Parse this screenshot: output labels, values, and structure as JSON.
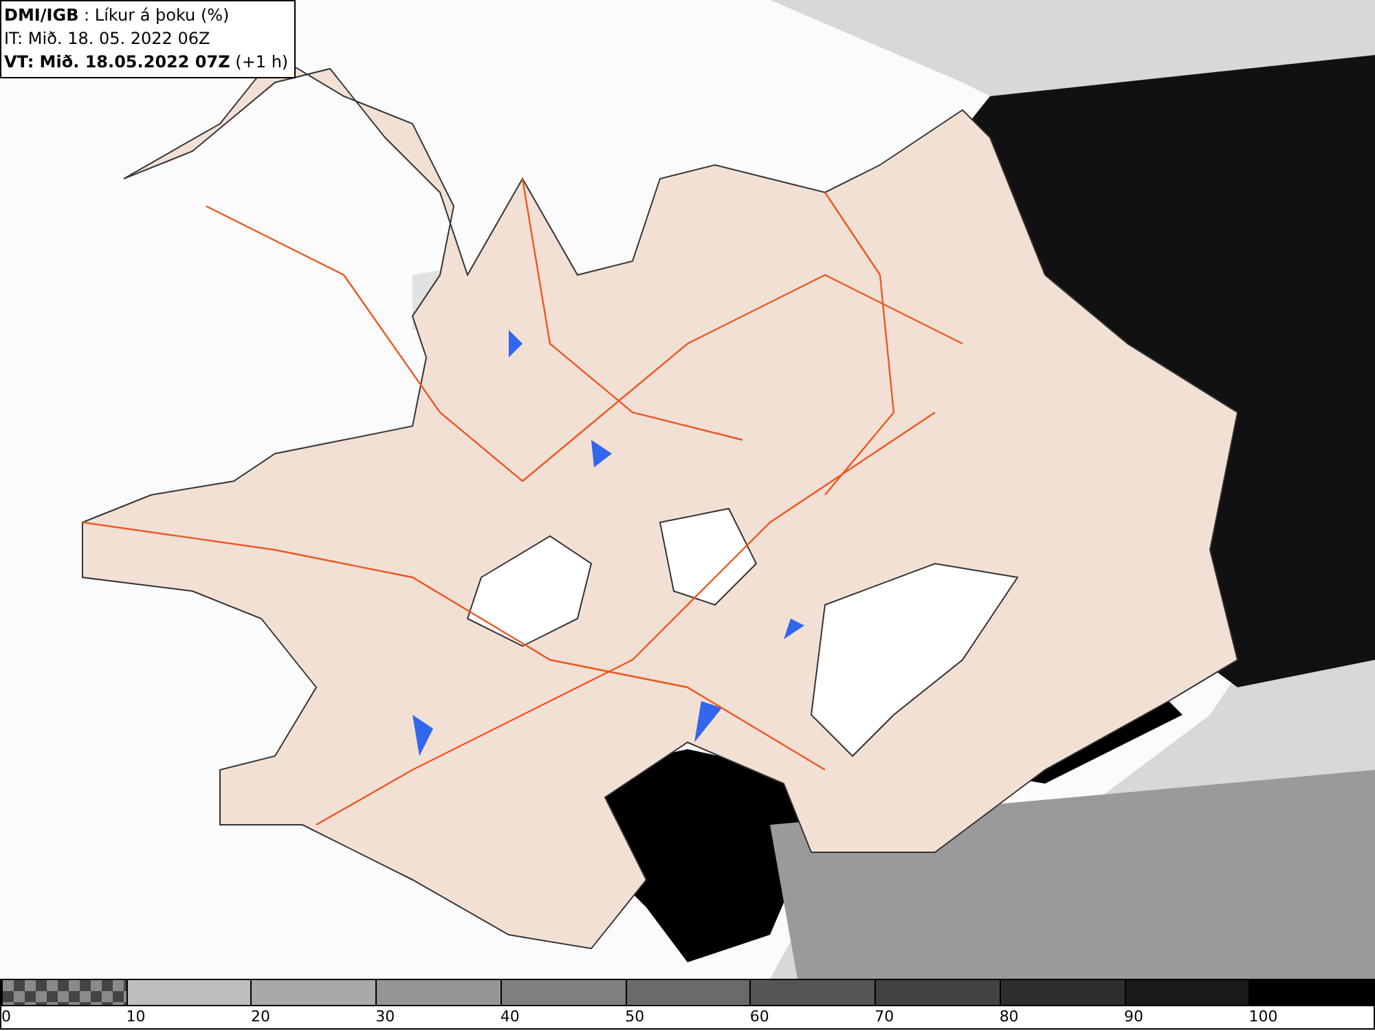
{
  "legend": {
    "lines": [
      "**DMI/IGB** : Líkur á þoku (%)",
      "IT: Mið. 18. 05. 2022 06Z",
      "**VT: Mið. 18.05.2022 07Z** (+1 h)"
    ]
  },
  "color_scale": [
    {
      "label": "0",
      "kind": "checker"
    },
    {
      "label": "10",
      "kind": "solid",
      "color": "#bdbdbd"
    },
    {
      "label": "20",
      "kind": "solid",
      "color": "#a9a9a9"
    },
    {
      "label": "30",
      "kind": "solid",
      "color": "#959595"
    },
    {
      "label": "40",
      "kind": "solid",
      "color": "#7f7f7f"
    },
    {
      "label": "50",
      "kind": "solid",
      "color": "#6a6a6a"
    },
    {
      "label": "60",
      "kind": "solid",
      "color": "#555555"
    },
    {
      "label": "70",
      "kind": "solid",
      "color": "#424242"
    },
    {
      "label": "80",
      "kind": "solid",
      "color": "#2e2e2e"
    },
    {
      "label": "90",
      "kind": "solid",
      "color": "#1a1a1a"
    },
    {
      "label": "100",
      "kind": "solid",
      "color": "#000000"
    }
  ]
}
